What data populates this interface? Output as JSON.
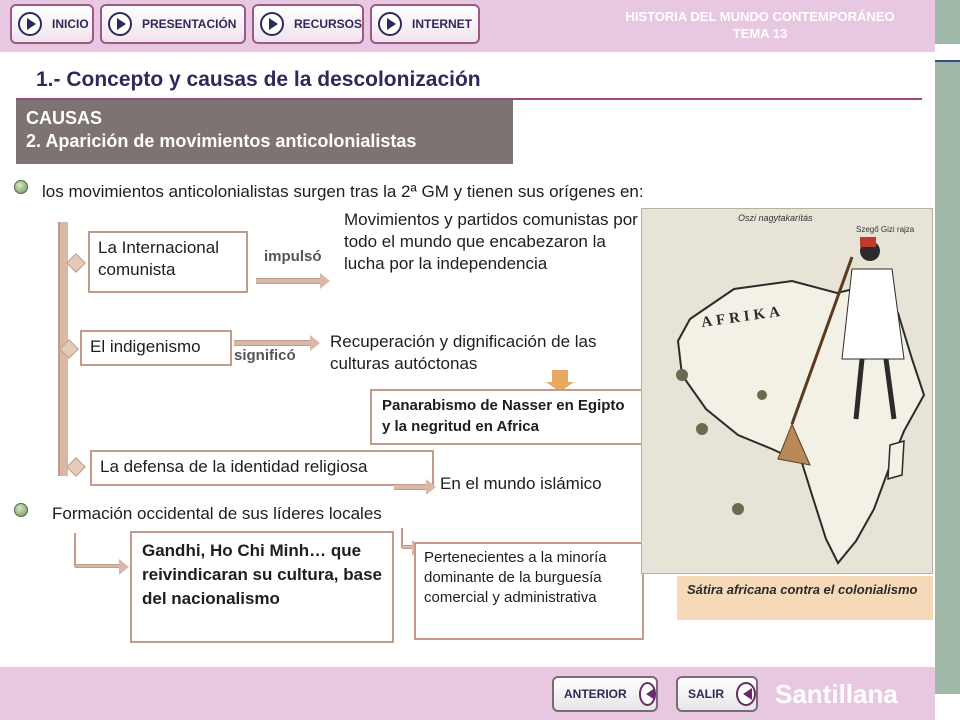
{
  "nav": {
    "inicio": "INICIO",
    "presentacion": "PRESENTACIÓN",
    "recursos": "RECURSOS",
    "internet": "INTERNET"
  },
  "course": {
    "title": "HISTORIA DEL MUNDO CONTEMPORÁNEO",
    "unit": "TEMA 13"
  },
  "section_title": "1.- Concepto y causas de la descolonización",
  "causas_box": {
    "line1": "CAUSAS",
    "line2": "2. Aparición de movimientos anticolonialistas"
  },
  "point1": "los movimientos anticolonialistas  surgen tras la 2ª GM y tienen sus orígenes en:",
  "diagram": {
    "internacional": "La Internacional comunista",
    "impulso": "impulsó",
    "internacional_result": "Movimientos y partidos comunistas por todo el mundo que encabezaron la lucha por la independencia",
    "indigenismo": "El indigenismo",
    "significo": "significó",
    "indigenismo_result": "Recuperación y dignificación de las culturas autóctonas",
    "panarabismo": "Panarabismo de Nasser en Egipto y la negritud en Africa",
    "religiosa": "La defensa de la identidad religiosa",
    "religiosa_result": "En el mundo islámico"
  },
  "point2": "Formación occidental de sus líderes locales",
  "leaders": {
    "names": "Gandhi, Ho Chi Minh… que reivindicaran su cultura, base del nacionalismo",
    "minority": "Pertenecientes a la minoría dominante de la burguesía comercial y administrativa"
  },
  "image": {
    "top_left": "Oszi nagytakarítás",
    "top_right": "Szegő Gizi rajza",
    "map_label": "AFRIKA",
    "caption": "Sátira africana contra el colonialismo"
  },
  "footer": {
    "anterior": "ANTERIOR",
    "salir": "SALIR",
    "brand": "Santillana"
  },
  "colors": {
    "bar": "#e8c8e0",
    "accent": "#a2477a",
    "box_border": "#c49a8a",
    "causas_bg": "#7d7472"
  }
}
